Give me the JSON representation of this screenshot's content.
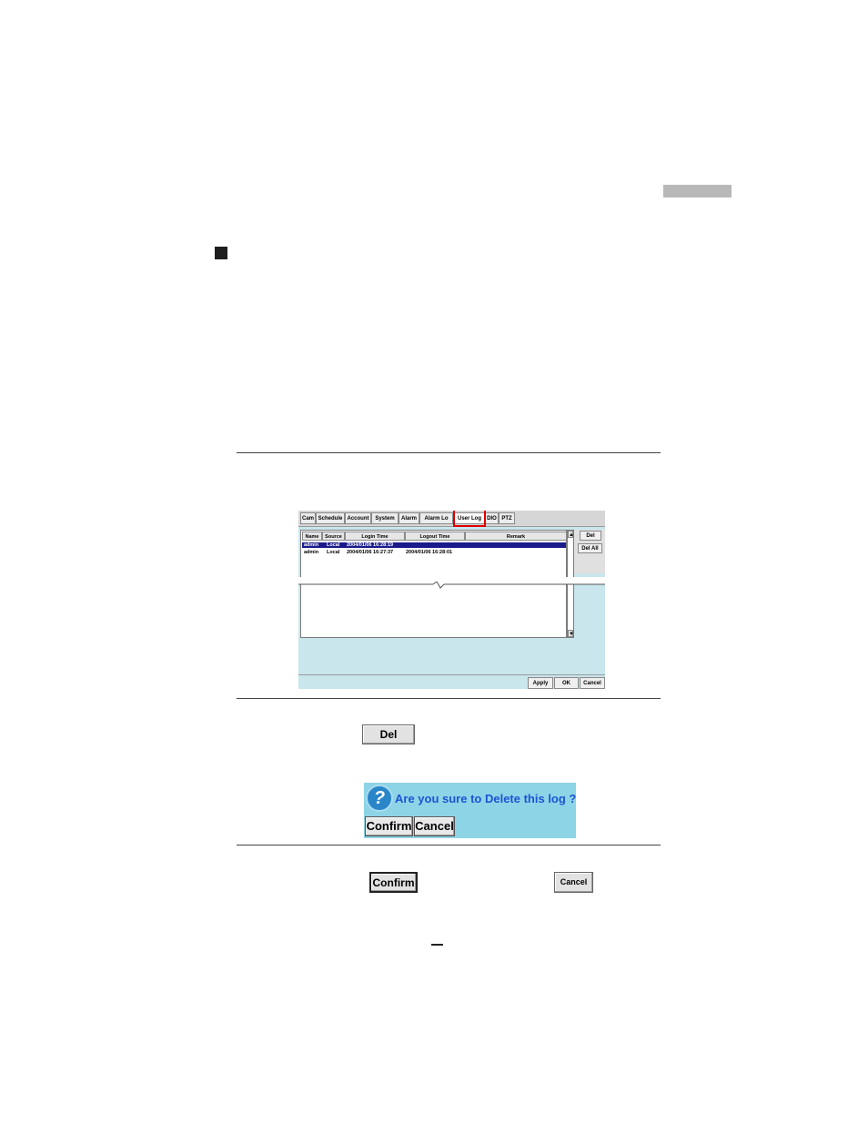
{
  "tabs": [
    "Cam",
    "Schedule",
    "Account",
    "System",
    "Alarm",
    "Alarm Lo",
    "User Log",
    "DIO",
    "PTZ"
  ],
  "active_tab": "User Log",
  "table": {
    "headers": [
      "Name",
      "Source",
      "Login Time",
      "Logout Time",
      "Remark"
    ],
    "rows": [
      {
        "name": "admin",
        "source": "Local",
        "login": "2004/01/06 16:28:19",
        "logout": "",
        "remark": ""
      },
      {
        "name": "admin",
        "source": "Local",
        "login": "2004/01/06 16:27:37",
        "logout": "2004/01/06 16:28:01",
        "remark": ""
      }
    ]
  },
  "side_buttons": {
    "del": "Del",
    "del_all": "Del All"
  },
  "bottom_buttons": {
    "apply": "Apply",
    "ok": "OK",
    "cancel": "Cancel"
  },
  "del_button": "Del",
  "dialog": {
    "message": "Are you sure to Delete this log ?",
    "icon": "question-icon",
    "confirm": "Confirm",
    "cancel": "Cancel"
  },
  "confirm_button": "Confirm",
  "cancel_button": "Cancel",
  "colors": {
    "dialog_bg": "#8dd4e6",
    "dialog_text": "#1b55d4",
    "panel_bg": "#c8e6ec",
    "highlight": "#e00000",
    "selection": "#1a1a8c"
  }
}
